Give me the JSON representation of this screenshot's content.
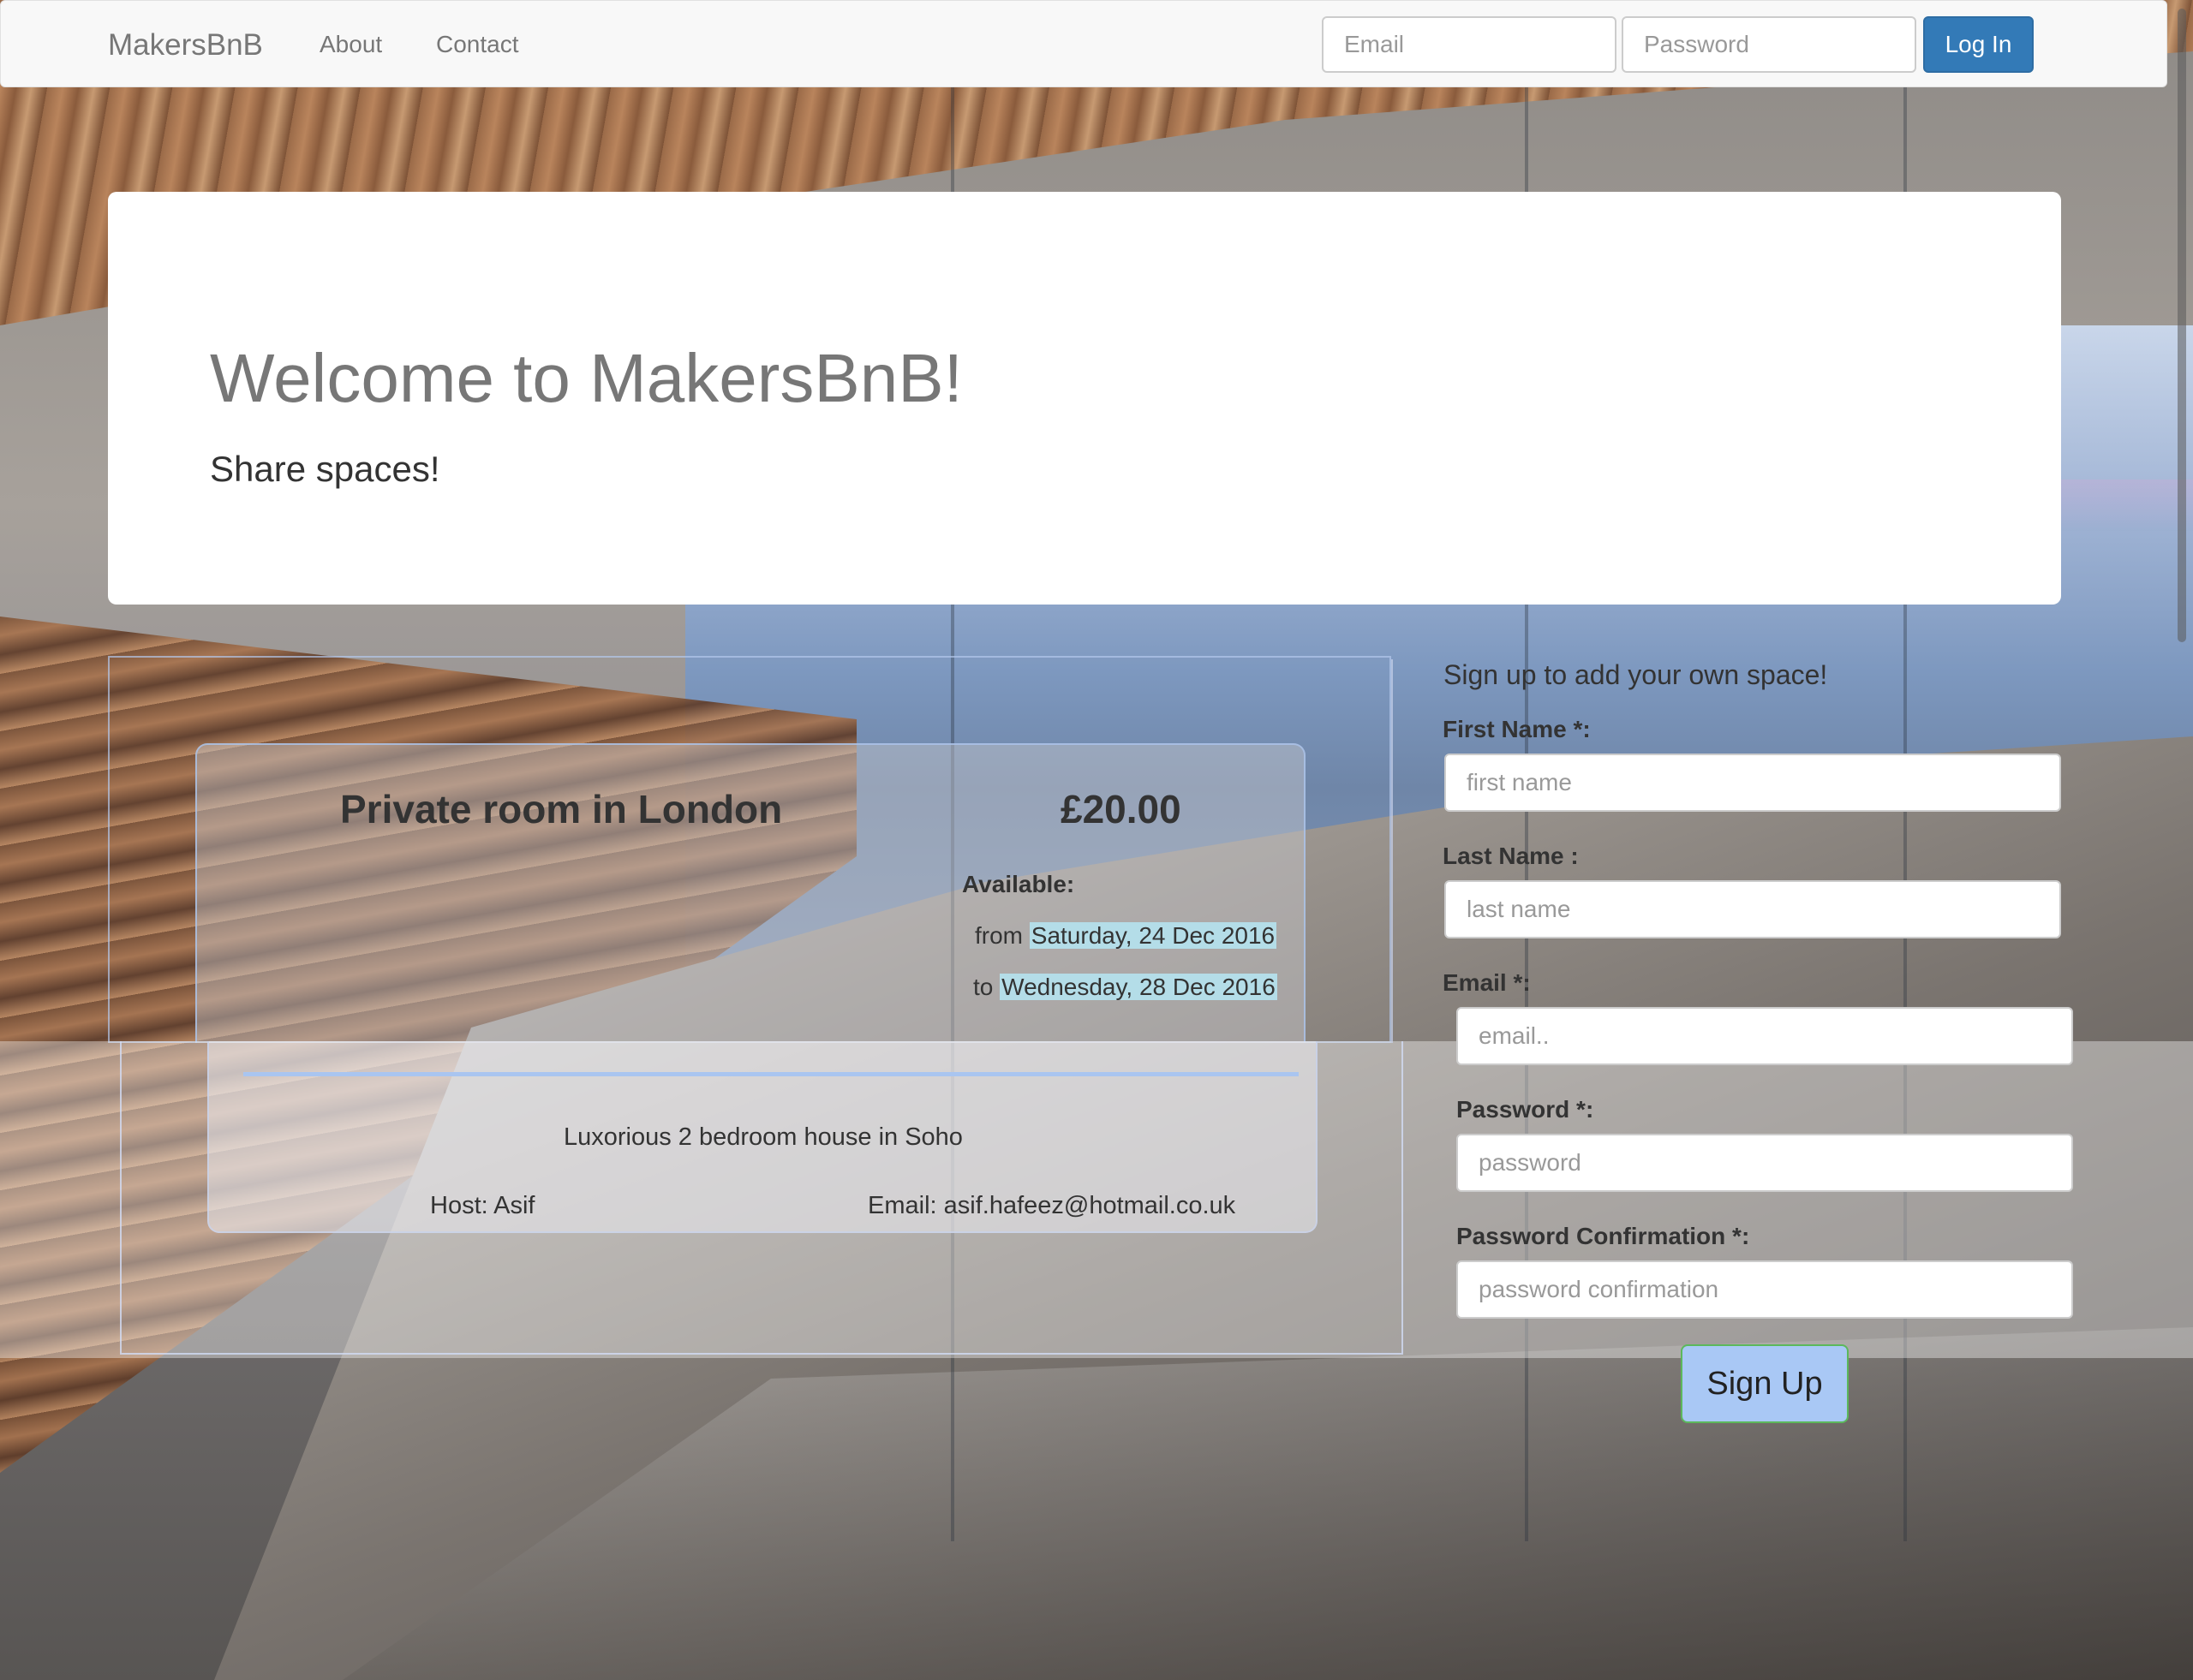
{
  "navbar": {
    "brand": "MakersBnB",
    "links": [
      "About",
      "Contact"
    ],
    "email_placeholder": "Email",
    "password_placeholder": "Password",
    "login_label": "Log In"
  },
  "jumbotron": {
    "heading": "Welcome to MakersBnB!",
    "tagline": "Share spaces!"
  },
  "listing": {
    "title": "Private room in London",
    "price": "£20.00",
    "available_label": "Available:",
    "from_prefix": "from",
    "from_date": "Saturday, 24 Dec 2016",
    "to_prefix": "to",
    "to_date": "Wednesday, 28 Dec 2016",
    "description": "Luxorious 2 bedroom house in Soho",
    "host": "Host: Asif",
    "email": "Email: asif.hafeez@hotmail.co.uk"
  },
  "signup": {
    "title": "Sign up to add your own space!",
    "first_name_label": "First Name *:",
    "first_name_placeholder": "first name",
    "last_name_label": "Last Name :",
    "last_name_placeholder": "last name",
    "email_label": "Email *:",
    "email_placeholder": "email..",
    "password_label": "Password *:",
    "password_placeholder": "password",
    "password_confirm_label": "Password Confirmation *:",
    "password_confirm_placeholder": "password confirmation",
    "submit_label": "Sign Up"
  },
  "colors": {
    "primary": "#337ab7",
    "date_highlight": "#b4dde8",
    "signup_button": "#a9c8f5"
  }
}
